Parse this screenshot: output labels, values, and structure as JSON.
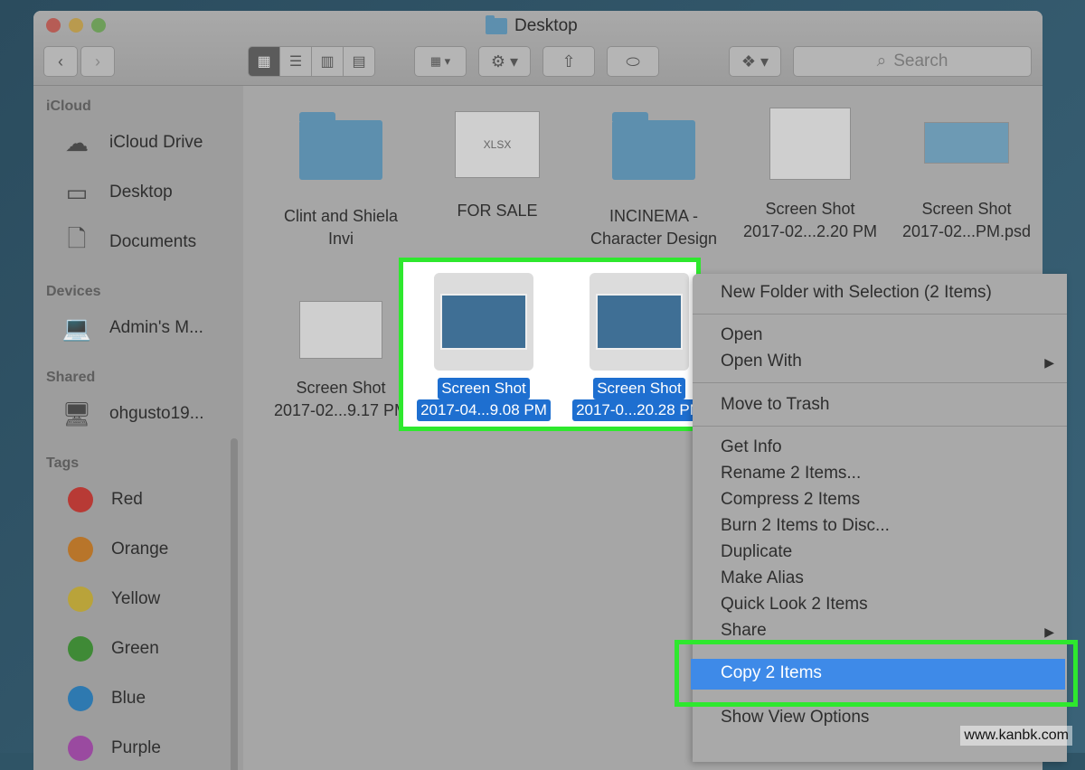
{
  "window": {
    "title": "Desktop"
  },
  "toolbar": {
    "back": "‹",
    "forward": "›",
    "search_placeholder": "Search"
  },
  "sidebar": {
    "sections": {
      "icloud": "iCloud",
      "devices": "Devices",
      "shared": "Shared",
      "tags": "Tags"
    },
    "icloud_items": [
      "iCloud Drive",
      "Desktop",
      "Documents"
    ],
    "device_items": [
      "Admin's M..."
    ],
    "shared_items": [
      "ohgusto19..."
    ],
    "tags": [
      {
        "label": "Red",
        "color": "#b83a35"
      },
      {
        "label": "Orange",
        "color": "#b8752a"
      },
      {
        "label": "Yellow",
        "color": "#b9a33a"
      },
      {
        "label": "Green",
        "color": "#3f8a36"
      },
      {
        "label": "Blue",
        "color": "#2e79b0"
      },
      {
        "label": "Purple",
        "color": "#9a4aa0"
      }
    ]
  },
  "files": [
    {
      "line1": "Clint and Shiela",
      "line2": "Invi"
    },
    {
      "line1": "FOR SALE",
      "line2": ""
    },
    {
      "line1": "INCINEMA -",
      "line2": "Character Design"
    },
    {
      "line1": "Screen Shot",
      "line2": "2017-02...2.20 PM"
    },
    {
      "line1": "Screen Shot",
      "line2": "2017-02...PM.psd"
    },
    {
      "line1": "Screen Shot",
      "line2": "2017-02...9.17 PM"
    }
  ],
  "xlsx_label": "XLSX",
  "selected_files": [
    {
      "line1": "Screen Shot",
      "line2": "2017-04...9.08 PM"
    },
    {
      "line1": "Screen Shot",
      "line2": "2017-0...20.28 PM"
    }
  ],
  "context_menu": {
    "items": [
      "New Folder with Selection (2 Items)",
      "Open",
      "Open With",
      "Move to Trash",
      "Get Info",
      "Rename 2 Items...",
      "Compress 2 Items",
      "Burn 2 Items to Disc...",
      "Duplicate",
      "Make Alias",
      "Quick Look 2 Items",
      "Share",
      "Copy 2 Items",
      "Show View Options"
    ],
    "submenu_arrow": "▶"
  },
  "watermark": "www.kanbk.com",
  "colors": {
    "highlight_green": "#2ee82e",
    "selection_blue": "#1e6fd0",
    "menu_highlight": "#3e8ae8"
  }
}
